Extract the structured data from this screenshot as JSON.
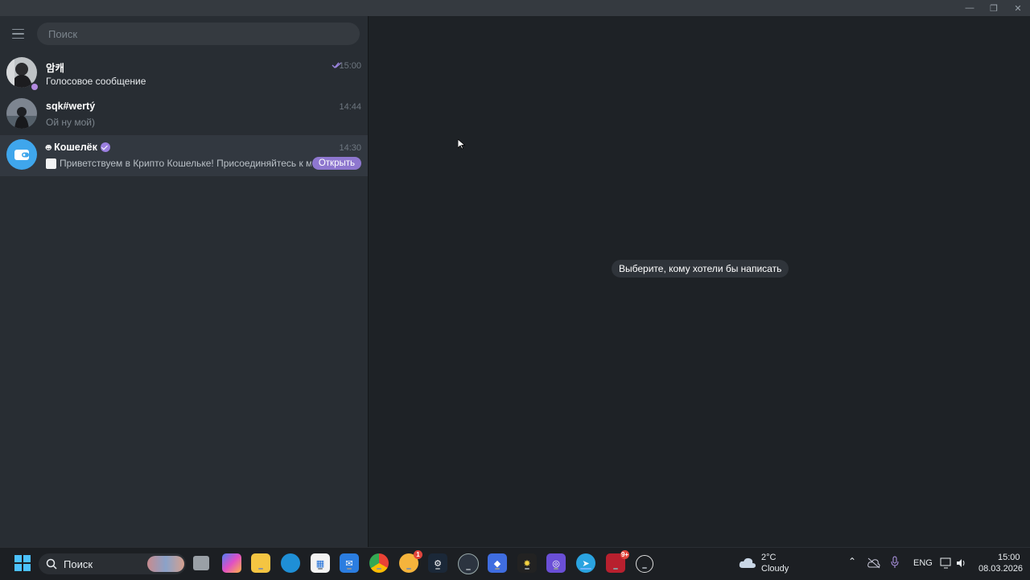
{
  "search": {
    "placeholder": "Поиск"
  },
  "chats": [
    {
      "name": "암캐",
      "time": "15:00",
      "preview": "Голосовое сообщение"
    },
    {
      "name": "sqk#wertý",
      "time": "14:44",
      "preview": "Ой ну мой)"
    },
    {
      "name": "Кошелёк",
      "time": "14:30",
      "preview": "Приветствуем в Крипто Кошельке!  Присоединяйтесь к ми...",
      "button": "Открыть"
    }
  ],
  "main": {
    "empty_text": "Выберите, кому хотели бы написать"
  },
  "taskbar": {
    "search_label": "Поиск",
    "weather_temp": "2°C",
    "weather_desc": "Cloudy",
    "language": "ENG",
    "time": "15:00",
    "date": "08.03.2026",
    "discord_badge": "1",
    "red_badge": "9+"
  },
  "colors": {
    "accent": "#8e77cf",
    "selected_row": "#323840",
    "sidebar": "#282d33",
    "main": "#1e2226"
  }
}
